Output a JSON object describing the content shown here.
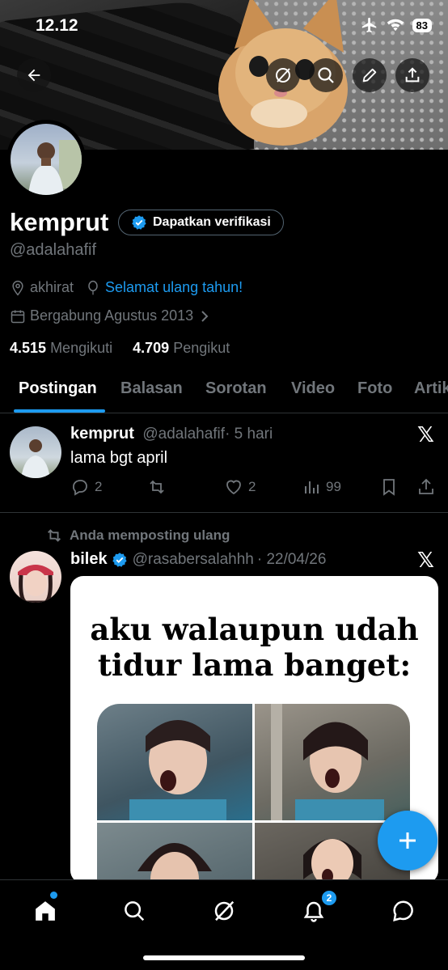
{
  "status_bar": {
    "time": "12.12",
    "battery": "83"
  },
  "header": {
    "icons": [
      "back-arrow-icon",
      "grok-icon",
      "search-icon",
      "edit-icon",
      "share-icon"
    ]
  },
  "profile": {
    "name": "kemprut",
    "verify_button": "Dapatkan verifikasi",
    "handle": "@adalahafif",
    "location": "akhirat",
    "birthday_link": "Selamat ulang tahun!",
    "joined": "Bergabung Agustus 2013",
    "following_count": "4.515",
    "following_label": "Mengikuti",
    "followers_count": "4.709",
    "followers_label": "Pengikut"
  },
  "tabs": [
    "Postingan",
    "Balasan",
    "Sorotan",
    "Video",
    "Foto",
    "Artik"
  ],
  "active_tab": "Postingan",
  "posts": [
    {
      "name": "kemprut",
      "handle": "@adalahafif",
      "time": "· 5 hari",
      "text": "lama bgt april",
      "replies": "2",
      "likes": "2",
      "views": "99"
    },
    {
      "repost_label": "Anda memposting ulang",
      "name": "bilek",
      "handle": "@rasabersalahhh",
      "time": "· 22/04/26",
      "verified": true,
      "media_text": "aku walaupun udah tidur lama banget:",
      "media_line1": "aku walaupun udah",
      "media_line2": "tidur lama banget:"
    }
  ],
  "bottom_nav": {
    "items": [
      "home-icon",
      "search-icon",
      "grok-icon",
      "notifications-icon",
      "messages-icon"
    ],
    "notification_badge": "2"
  },
  "colors": {
    "accent": "#1d9bf0",
    "background": "#000000",
    "muted": "#71767b",
    "divider": "#2f3336"
  }
}
